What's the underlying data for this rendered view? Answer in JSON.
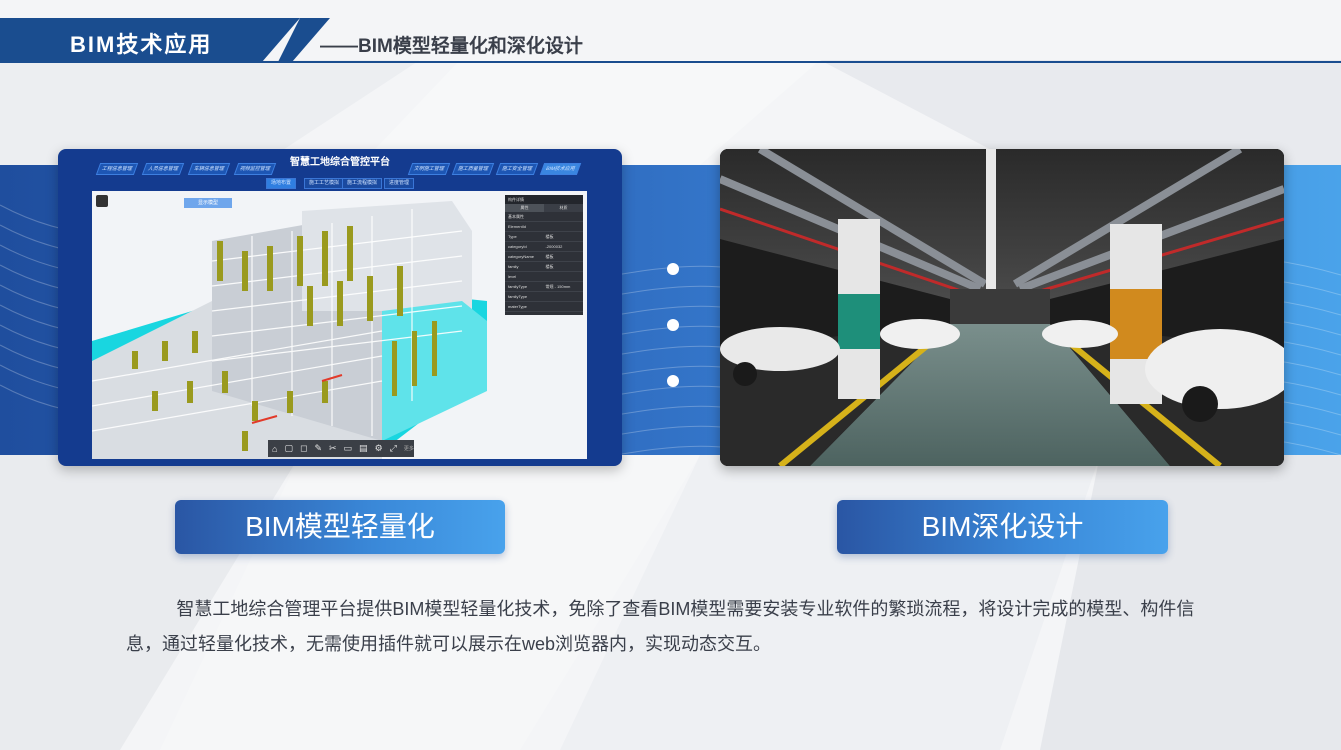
{
  "header": {
    "section_title": "BIM技术应用",
    "subtitle": "——BIM模型轻量化和深化设计"
  },
  "left_panel": {
    "platform_title": "智慧工地综合管控平台",
    "nav_tabs": [
      "工程信息管理",
      "人员信息管理",
      "车辆信息管理",
      "视频监控管理",
      "文明施工管理",
      "施工质量管理",
      "施工安全管理",
      "BIM技术应用"
    ],
    "sub_tabs": [
      "场地布置",
      "施工工艺模拟",
      "施工流程模拟",
      "进度管理"
    ],
    "viewport_chip": "显示模型",
    "property_panel": {
      "title": "构件详情",
      "tabs": [
        "属性",
        "材质"
      ],
      "rows": [
        [
          "基本属性",
          ""
        ],
        [
          "ElementId",
          ""
        ],
        [
          "Type",
          "楼板"
        ],
        [
          "categoryId",
          "-2000032"
        ],
        [
          "categoryName",
          "楼板"
        ],
        [
          "family",
          "楼板"
        ],
        [
          "level",
          ""
        ],
        [
          "familyType",
          "常规 - 150mm"
        ],
        [
          "familyType",
          ""
        ],
        [
          "materType",
          ""
        ]
      ]
    },
    "toolbar_label": "更多"
  },
  "right_panel": {
    "description": "underground parking garage rendering"
  },
  "labels": {
    "left": "BIM模型轻量化",
    "right": "BIM深化设计"
  },
  "description": "智慧工地综合管理平台提供BIM模型轻量化技术，免除了查看BIM模型需要安装专业软件的繁琐流程，将设计完成的模型、构件信息，通过轻量化技术，无需使用插件就可以展示在web浏览器内，实现动态交互。",
  "colors": {
    "brand_blue": "#1a4d8f",
    "band_start": "#1f4e9e",
    "band_end": "#4aa3ea"
  }
}
